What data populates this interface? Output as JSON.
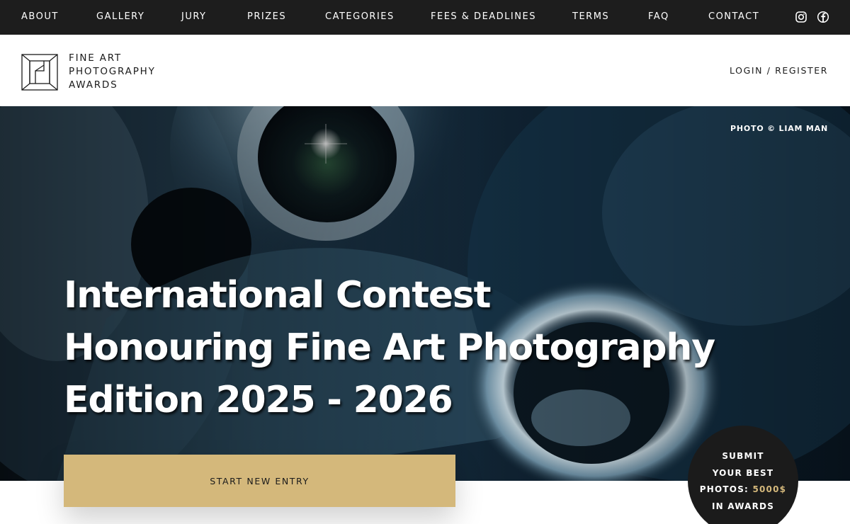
{
  "nav": {
    "items": [
      {
        "label": "ABOUT"
      },
      {
        "label": "GALLERY"
      },
      {
        "label": "JURY"
      },
      {
        "label": "PRIZES"
      },
      {
        "label": "CATEGORIES"
      },
      {
        "label": "FEES & DEADLINES"
      },
      {
        "label": "TERMS"
      },
      {
        "label": "FAQ"
      },
      {
        "label": "CONTACT"
      }
    ],
    "icons": [
      "instagram-icon",
      "facebook-icon"
    ]
  },
  "brand": {
    "line1": "FINE ART",
    "line2": "PHOTOGRAPHY",
    "line3": "AWARDS",
    "login_label": "LOGIN / REGISTER"
  },
  "hero": {
    "credit": "PHOTO © LIAM MAN",
    "headline": {
      "line1": "International Contest",
      "line2": "Honouring Fine Art Photography",
      "line3": "Edition 2025 - 2026"
    }
  },
  "cta": {
    "label": "START NEW ENTRY"
  },
  "badge": {
    "line1": "SUBMIT",
    "line2": "YOUR BEST",
    "line3_prefix": "PHOTOS:",
    "line3_amount": "5000$",
    "line4": "IN AWARDS"
  },
  "colors": {
    "nav_bg": "#1d1d1d",
    "accent_gold": "#d4b87b",
    "badge_bg": "#1b1b1b"
  }
}
